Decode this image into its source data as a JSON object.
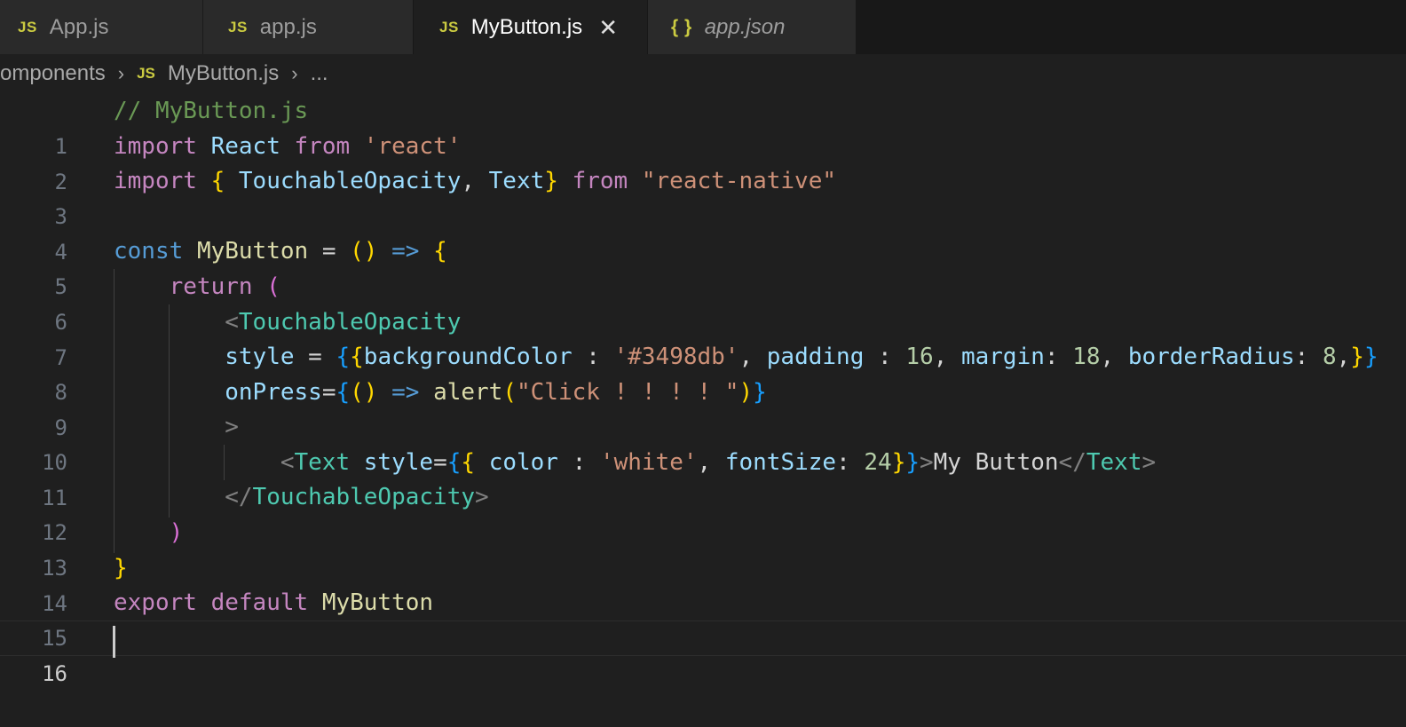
{
  "tabs": [
    {
      "icon": "JS",
      "label": "App.js"
    },
    {
      "icon": "JS",
      "label": "app.js"
    },
    {
      "icon": "JS",
      "label": "MyButton.js",
      "close": "✕"
    },
    {
      "icon": "{ }",
      "label": "app.json"
    }
  ],
  "breadcrumb": {
    "folder": "components",
    "file_icon": "JS",
    "file": "MyButton.js",
    "more": "..."
  },
  "line_numbers": [
    "1",
    "2",
    "3",
    "4",
    "5",
    "6",
    "7",
    "8",
    "9",
    "10",
    "11",
    "12",
    "13",
    "14",
    "15",
    "16"
  ],
  "code": {
    "l1": "// MyButton.js",
    "import": "import",
    "from": "from",
    "React": "React",
    "react_str": "'react'",
    "brace_open": "{",
    "brace_close": "}",
    "TouchableOpacity": "TouchableOpacity",
    "comma": ",",
    "Text": "Text",
    "rn_str": "\"react-native\"",
    "const": "const",
    "MyButton": "MyButton",
    "eq": "=",
    "parens": "()",
    "arrow": "=>",
    "return": "return",
    "paren_open": "(",
    "paren_close": ")",
    "lt": "<",
    "gt": ">",
    "close_lt": "</",
    "style": "style",
    "double_open": "{{",
    "double_close": "}}",
    "backgroundColor": "backgroundColor",
    "colon": ":",
    "bg_str": "'#3498db'",
    "padding": "padding",
    "n16": "16",
    "margin": "margin",
    "n18": "18",
    "borderRadius": "borderRadius",
    "n8": "8",
    "onPress": "onPress",
    "alert": "alert",
    "alert_str": "\"Click ! ! ! ! \"",
    "color": "color",
    "white_str": "'white'",
    "fontSize": "fontSize",
    "n24": "24",
    "button_text": "My Button",
    "export": "export",
    "default": "default"
  },
  "colors": {
    "background": "#1f1f1f",
    "tab_inactive": "#2a2a2a",
    "js_icon": "#cbcb41"
  }
}
